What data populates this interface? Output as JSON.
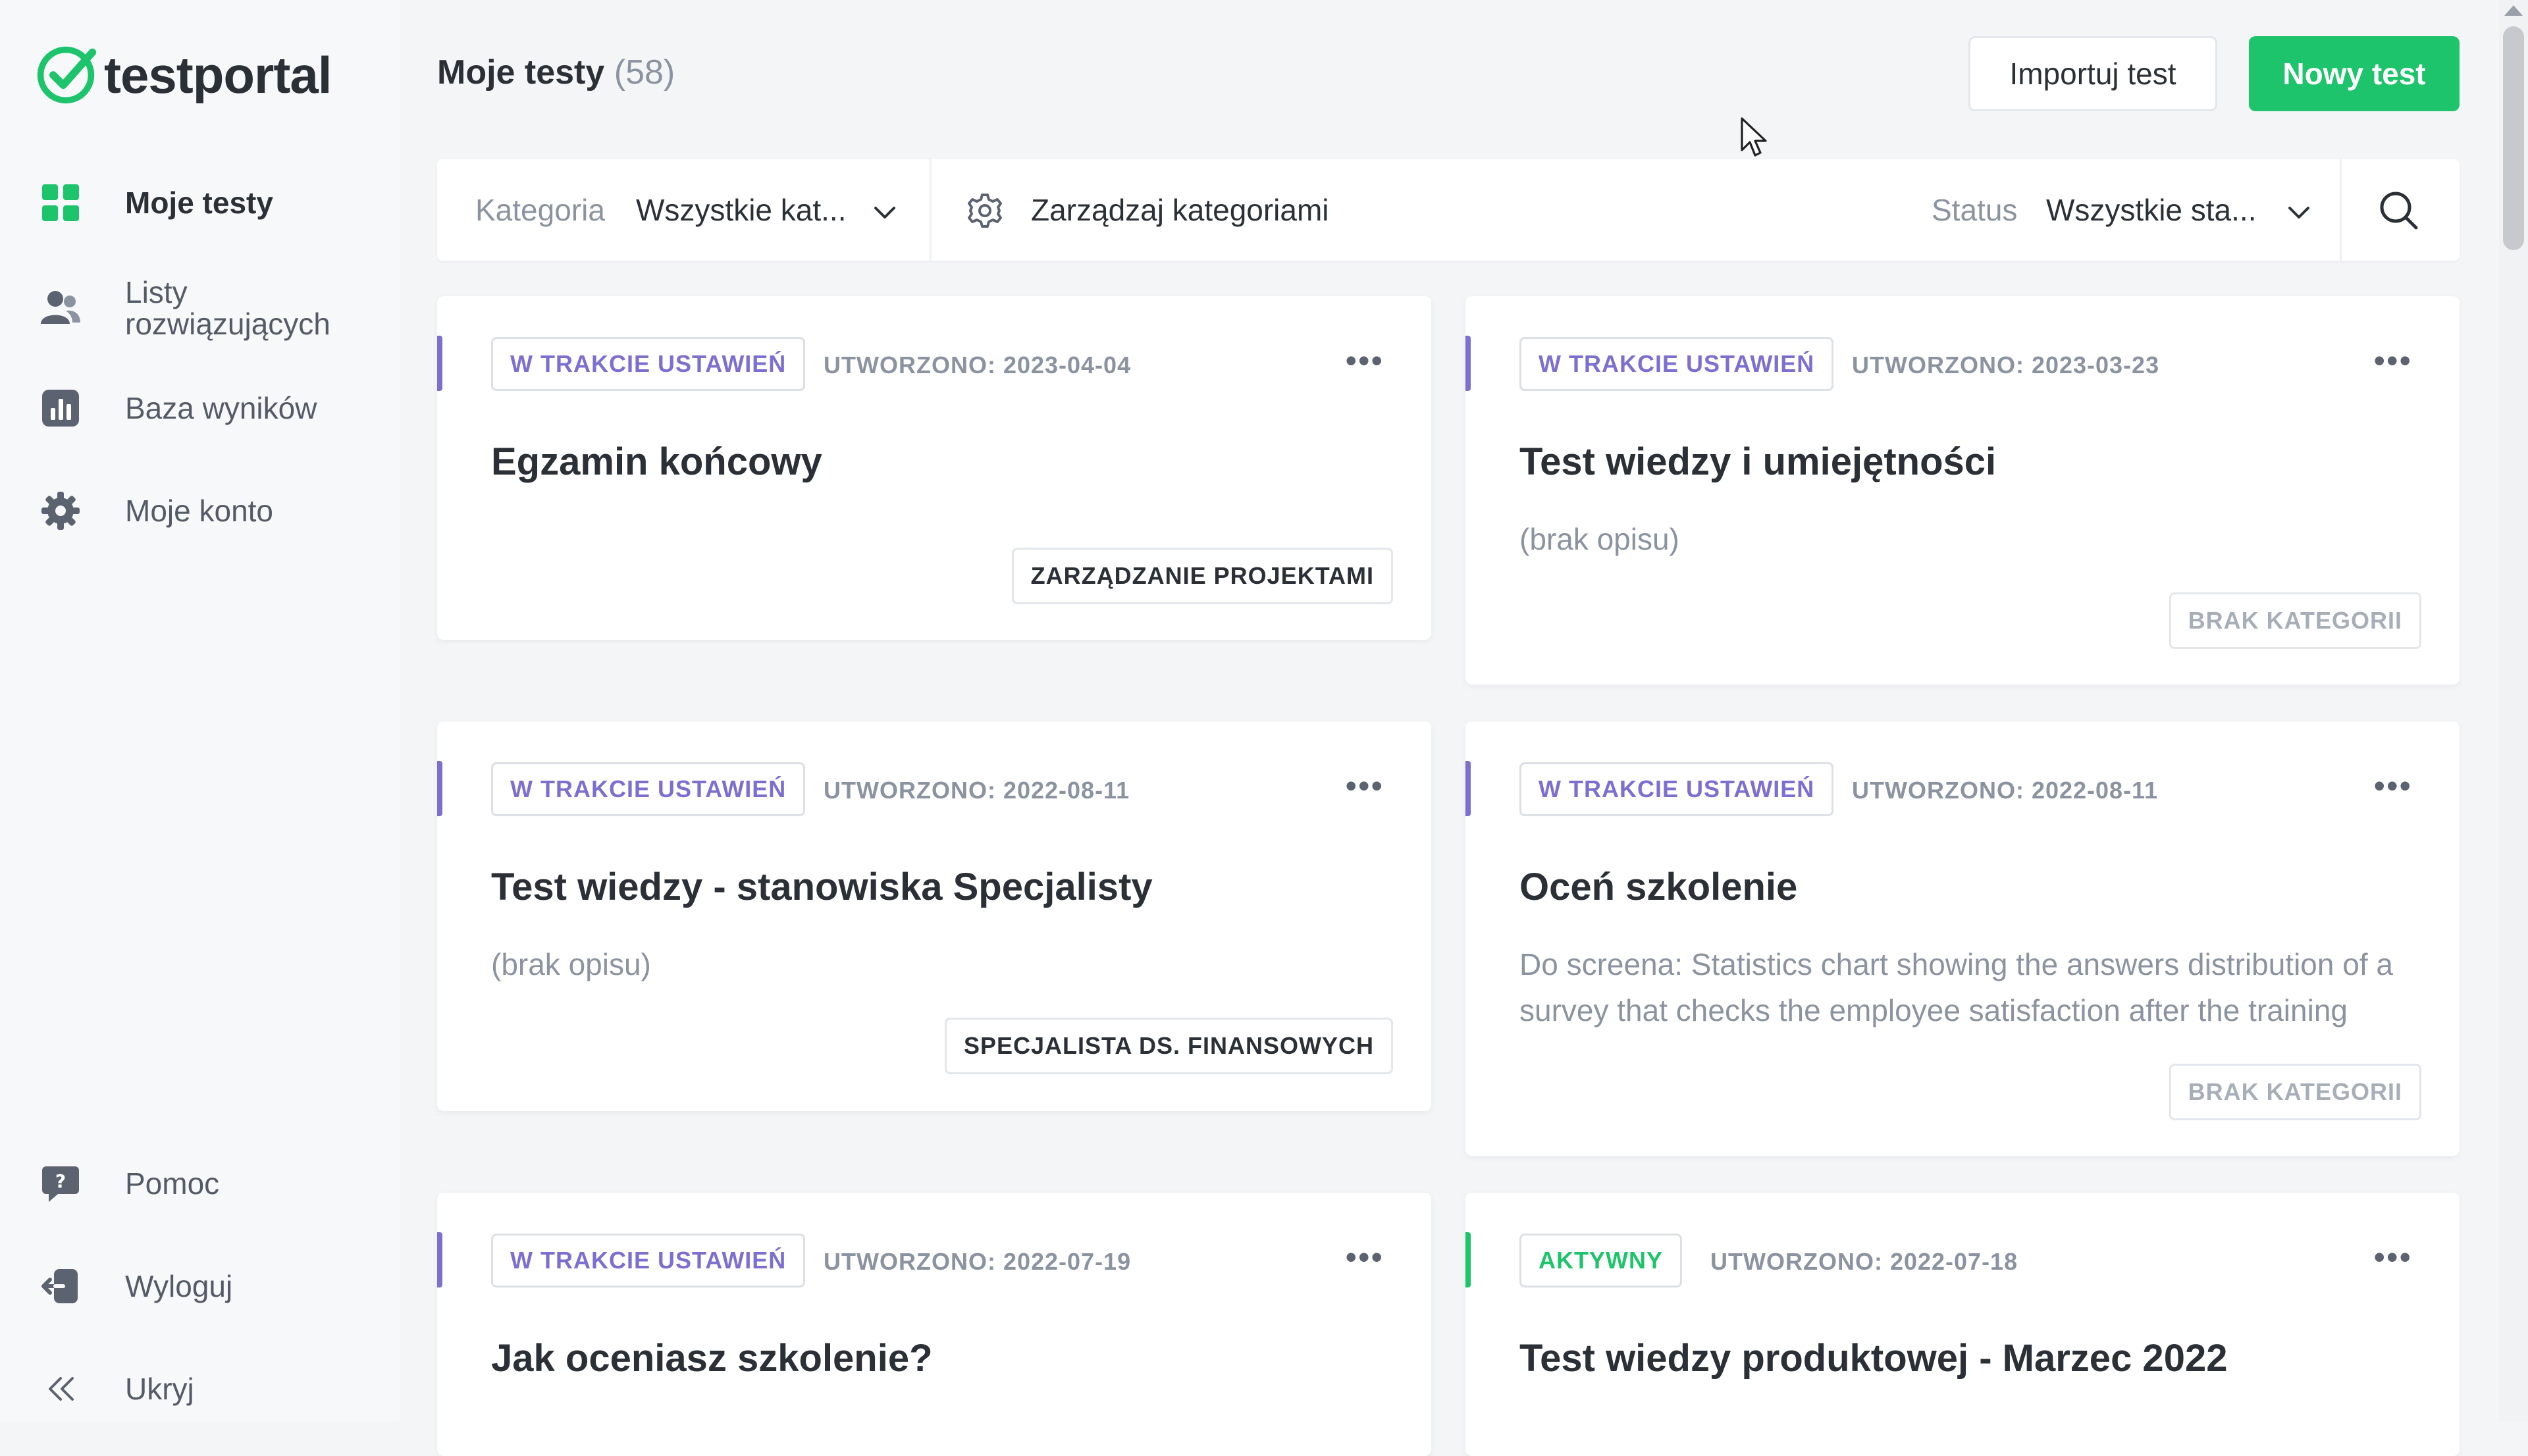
{
  "app": {
    "logo_text": "testportal",
    "brand_color": "#1ec46b"
  },
  "sidebar": {
    "items": [
      {
        "label": "Moje testy",
        "icon": "grid-icon",
        "active": true
      },
      {
        "label": "Listy rozwiązujących",
        "icon": "users-icon"
      },
      {
        "label": "Baza wyników",
        "icon": "chart-icon"
      },
      {
        "label": "Moje konto",
        "icon": "gear-icon"
      }
    ],
    "bottom": [
      {
        "label": "Pomoc",
        "icon": "help-icon"
      },
      {
        "label": "Wyloguj",
        "icon": "logout-icon"
      },
      {
        "label": "Ukryj",
        "icon": "collapse-icon"
      }
    ]
  },
  "header": {
    "title": "Moje testy",
    "count": "(58)",
    "import_label": "Importuj test",
    "new_label": "Nowy test"
  },
  "filters": {
    "category_label": "Kategoria",
    "category_value": "Wszystkie kat...",
    "manage_label": "Zarządzaj kategoriami",
    "status_label": "Status",
    "status_value": "Wszystkie sta..."
  },
  "cards": [
    {
      "status": "W TRAKCIE USTAWIEŃ",
      "created": "UTWORZONO: 2023-04-04",
      "title": "Egzamin końcowy",
      "description": "",
      "category": "ZARZĄDZANIE PROJEKTAMI"
    },
    {
      "status": "W TRAKCIE USTAWIEŃ",
      "created": "UTWORZONO: 2023-03-23",
      "title": "Test wiedzy i umiejętności",
      "description": "(brak opisu)",
      "category": "BRAK KATEGORII"
    },
    {
      "status": "W TRAKCIE USTAWIEŃ",
      "created": "UTWORZONO: 2022-08-11",
      "title": "Test wiedzy - stanowiska Specjalisty",
      "description": "(brak opisu)",
      "category": "SPECJALISTA DS. FINANSOWYCH"
    },
    {
      "status": "W TRAKCIE USTAWIEŃ",
      "created": "UTWORZONO: 2022-08-11",
      "title": "Oceń szkolenie",
      "description": "Do screena: Statistics chart showing the answers distribution of a survey that checks the employee satisfaction after the training",
      "category": "BRAK KATEGORII"
    },
    {
      "status": "W TRAKCIE USTAWIEŃ",
      "created": "UTWORZONO: 2022-07-19",
      "title": "Jak oceniasz szkolenie?",
      "description": "",
      "category": ""
    },
    {
      "status": "AKTYWNY",
      "created": "UTWORZONO: 2022-07-18",
      "title": "Test wiedzy produktowej - Marzec 2022",
      "description": "",
      "category": ""
    }
  ]
}
